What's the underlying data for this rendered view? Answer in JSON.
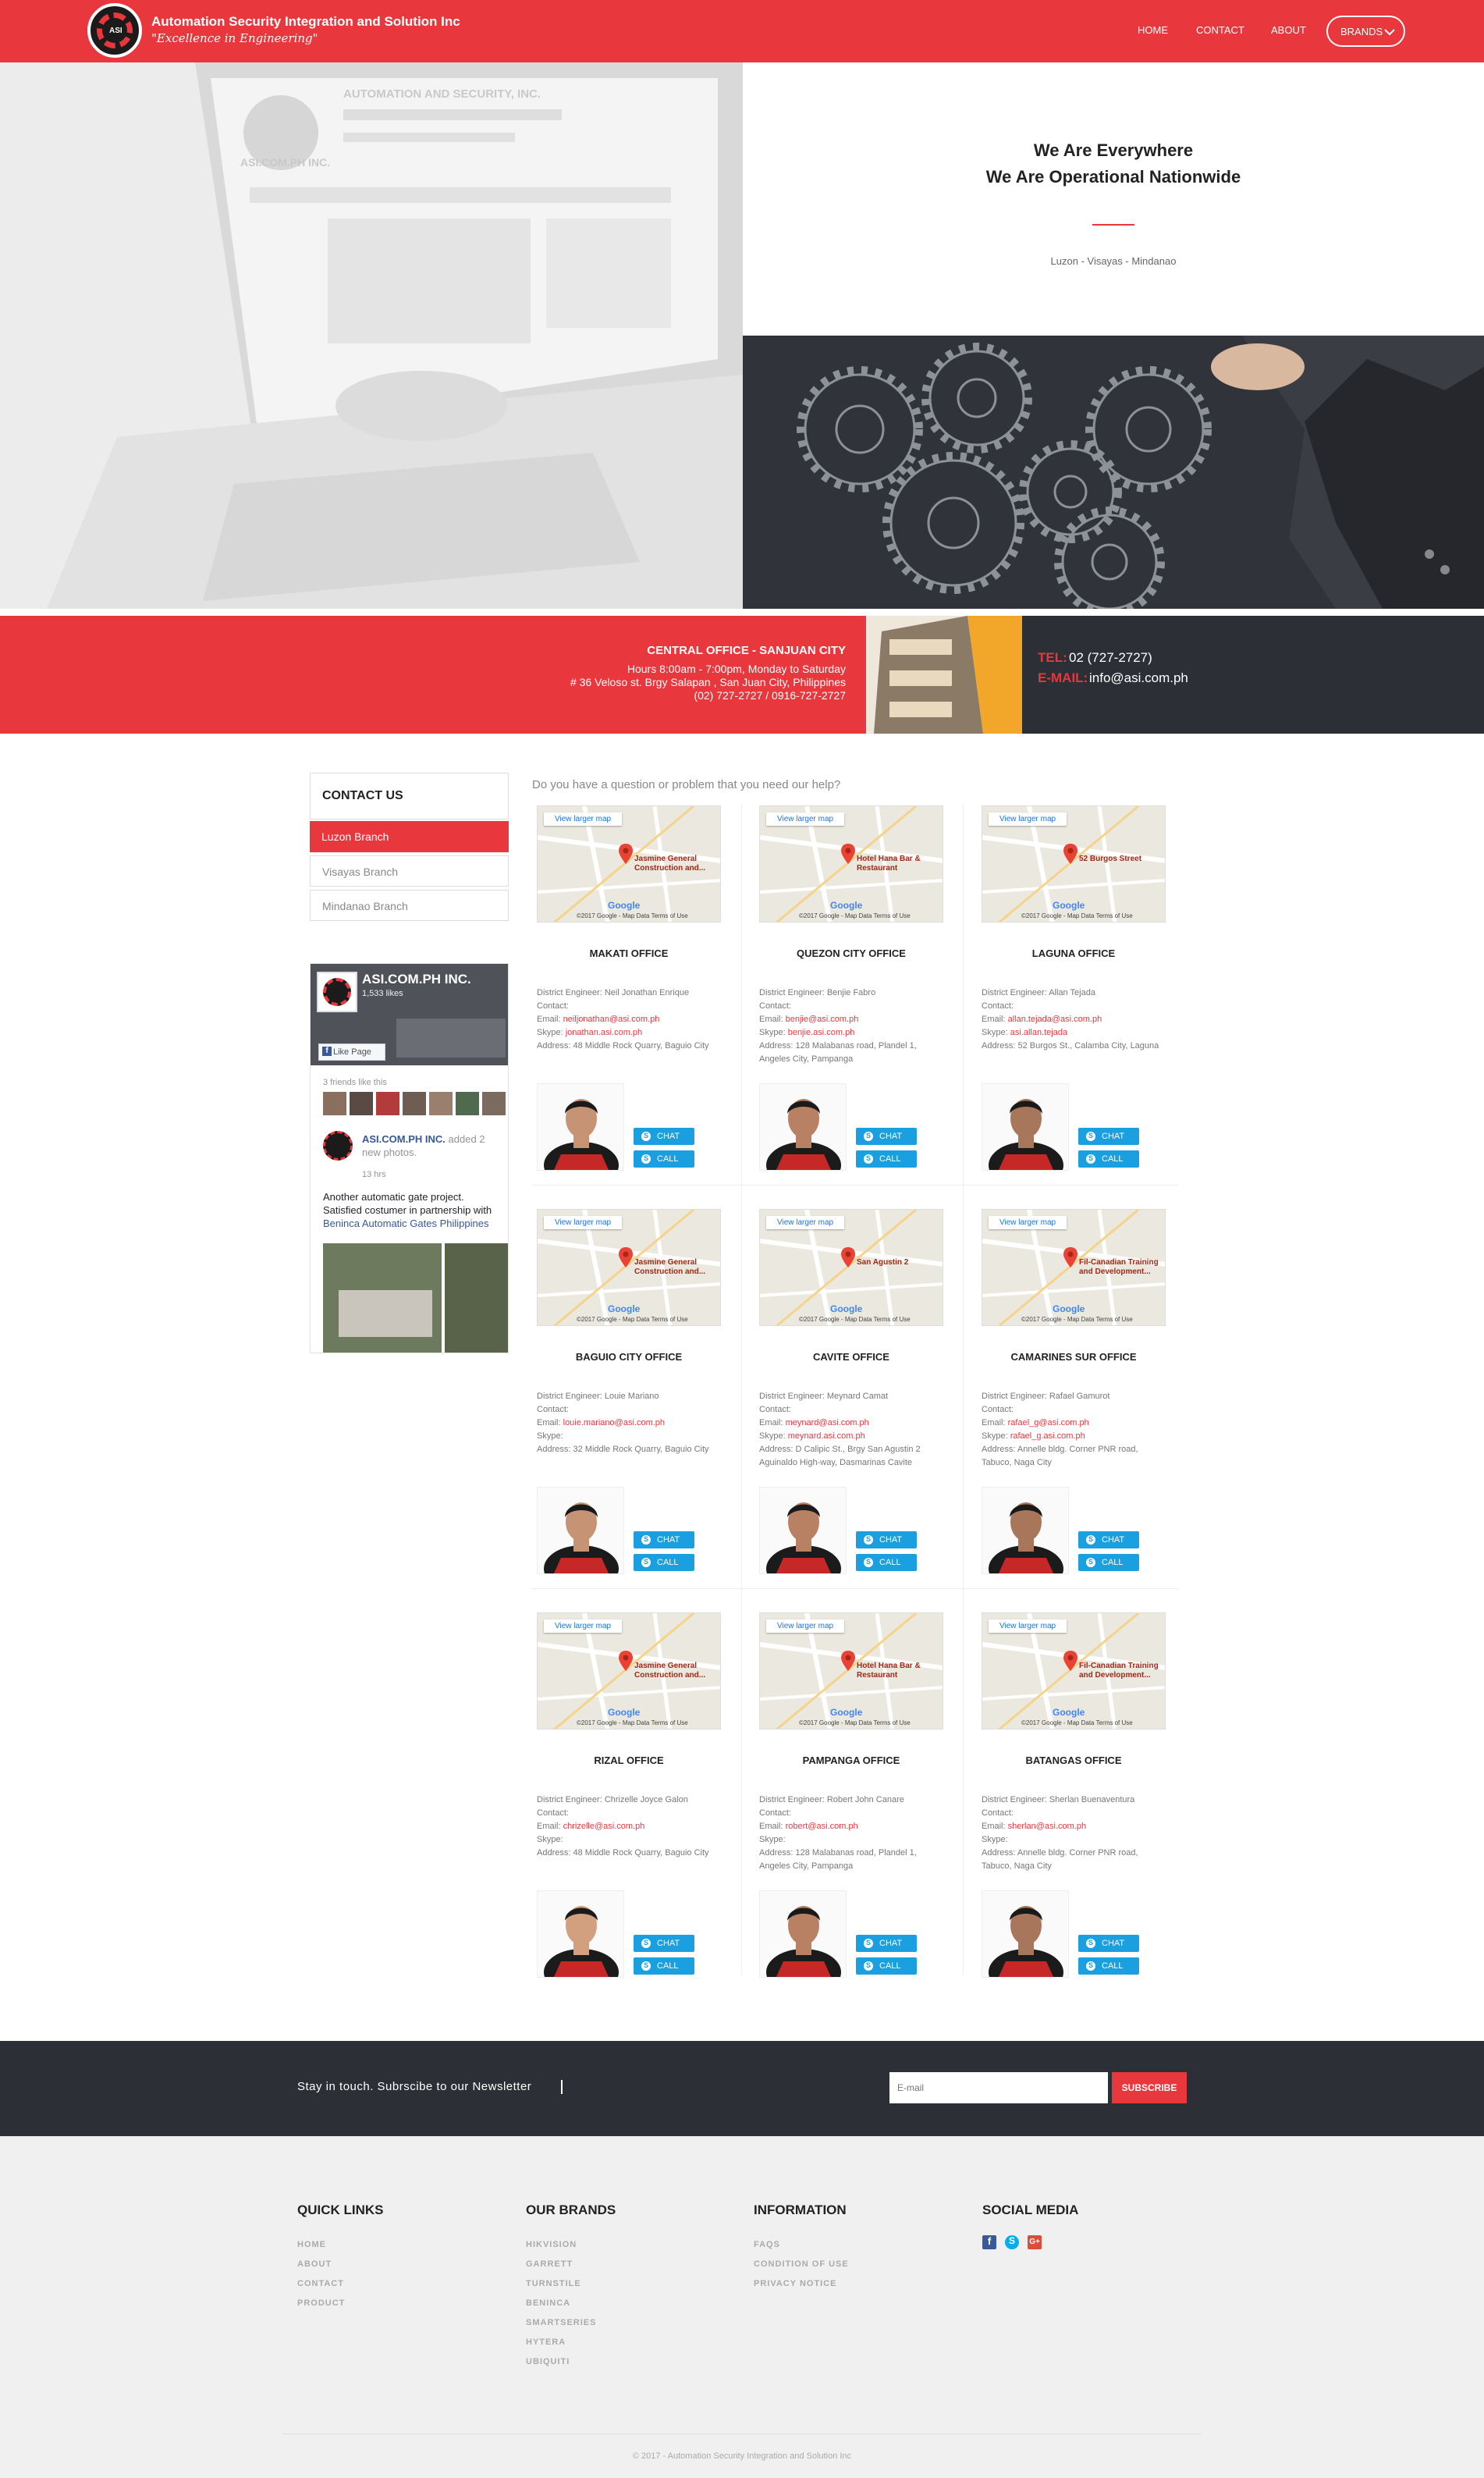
{
  "header": {
    "logo_text": "ASI",
    "brand_name": "Automation Security Integration and Solution Inc",
    "tagline": "\"Excellence in Engineering\"",
    "nav": [
      "HOME",
      "CONTACT",
      "ABOUT",
      "BRANDS"
    ]
  },
  "hero": {
    "title_line1": "We Are Everywhere",
    "title_line2": "We Are Operational Nationwide",
    "subtitle": "Luzon - Visayas - Mindanao",
    "screen_brand": "AUTOMATION AND SECURITY, INC.",
    "screen_site": "ASI.COM.PH INC."
  },
  "central": {
    "title": "CENTRAL OFFICE - SANJUAN CITY",
    "hours": "Hours 8:00am - 7:00pm, Monday to Saturday",
    "address": "# 36 Veloso st. Brgy Salapan , San Juan City, Philippines",
    "phones": "(02) 727-2727 / 0916-727-2727",
    "tel_label": "TEL:",
    "tel_value": "02 (727-2727)",
    "email_label": "E-MAIL:",
    "email_value": "info@asi.com.ph"
  },
  "sidebar": {
    "heading": "CONTACT US",
    "items": [
      "Luzon Branch",
      "Visayas Branch",
      "Mindanao Branch"
    ],
    "fb": {
      "page": "ASI.COM.PH INC.",
      "likes": "1,533 likes",
      "like_btn": "Like Page",
      "friends": "3 friends like this",
      "post_author": "ASI.COM.PH INC.",
      "post_action": "added 2 new photos.",
      "post_time": "13 hrs",
      "post_text1": "Another automatic gate project. Satisfied costumer in partnership with ",
      "post_link": "Beninca Automatic Gates Philippines"
    }
  },
  "main": {
    "question": "Do you have a question or problem that you need our help?",
    "map_link": "View larger map",
    "map_footer": "©2017 Google - Map Data   Terms of Use",
    "chat_label": "CHAT",
    "call_label": "CALL",
    "engineer_label": "District Engineer:",
    "contact_label": "Contact:",
    "email_label": "Email:",
    "skype_label": "Skype:",
    "address_label": "Address:",
    "offices": [
      {
        "title": "MAKATI OFFICE",
        "engineer": "Neil Jonathan Enrique",
        "email": "neiljonathan@asi.com.ph",
        "skype": "jonathan.asi.com.ph",
        "address": "48 Middle Rock Quarry, Baguio City",
        "map_pin": "Jasmine General Construction and..."
      },
      {
        "title": "QUEZON CITY OFFICE",
        "engineer": "Benjie Fabro",
        "email": "benjie@asi.com.ph",
        "skype": "benjie.asi.com.ph",
        "address": "128 Malabanas road, Plandel 1, Angeles City, Pampanga",
        "map_pin": "Hotel Hana Bar & Restaurant"
      },
      {
        "title": "LAGUNA OFFICE",
        "engineer": "Allan Tejada",
        "email": "allan.tejada@asi.com.ph",
        "skype": "asi.allan.tejada",
        "address": "52 Burgos St., Calamba City, Laguna",
        "map_pin": "52 Burgos Street"
      },
      {
        "title": "BAGUIO CITY OFFICE",
        "engineer": "Louie Mariano",
        "email": "louie.mariano@asi.com.ph",
        "skype": "",
        "address": "32 Middle Rock Quarry, Baguio City",
        "map_pin": "Jasmine General Construction and..."
      },
      {
        "title": "CAVITE OFFICE",
        "engineer": "Meynard Camat",
        "email": "meynard@asi.com.ph",
        "skype": "meynard.asi.com.ph",
        "address": "D Calipic St., Brgy San Agustin 2 Aguinaldo High-way, Dasmarinas Cavite",
        "map_pin": "San Agustin 2"
      },
      {
        "title": "CAMARINES SUR OFFICE",
        "engineer": "Rafael Gamurot",
        "email": "rafael_g@asi.com.ph",
        "skype": "rafael_g.asi.com.ph",
        "address": "Annelle bldg. Corner PNR road, Tabuco, Naga City",
        "map_pin": "Fil-Canadian Training and Development..."
      },
      {
        "title": "RIZAL OFFICE",
        "engineer": "Chrizelle Joyce Galon",
        "email": "chrizelle@asi.com.ph",
        "skype": "",
        "address": "48 Middle Rock Quarry, Baguio City",
        "map_pin": "Jasmine General Construction and..."
      },
      {
        "title": "PAMPANGA OFFICE",
        "engineer": "Robert John Canare",
        "email": "robert@asi.com.ph",
        "skype": "",
        "address": "128 Malabanas road, Plandel 1, Angeles City, Pampanga",
        "map_pin": "Hotel Hana Bar & Restaurant"
      },
      {
        "title": "BATANGAS OFFICE",
        "engineer": "Sherlan Buenaventura",
        "email": "sherlan@asi.com.ph",
        "skype": "",
        "address": "Annelle bldg. Corner PNR road, Tabuco, Naga City",
        "map_pin": "Fil-Canadian Training and Development..."
      }
    ]
  },
  "newsletter": {
    "text": "Stay in touch. Subrscibe to our Newsletter",
    "placeholder": "E-mail",
    "button": "SUBSCRIBE"
  },
  "footer": {
    "quick_links_title": "QUICK LINKS",
    "quick_links": [
      "HOME",
      "ABOUT",
      "CONTACT",
      "PRODUCT"
    ],
    "brands_title": "OUR BRANDS",
    "brands": [
      "HIKVISION",
      "GARRETT",
      "TURNSTILE",
      "BENINCA",
      "SMARTSERIES",
      "HYTERA",
      "UBIQUITI"
    ],
    "info_title": "INFORMATION",
    "info": [
      "FAQS",
      "CONDITION OF USE",
      "PRIVACY NOTICE"
    ],
    "social_title": "SOCIAL MEDIA",
    "social_icons": [
      "facebook-icon",
      "skype-icon",
      "google-plus-icon"
    ],
    "copyright": "© 2017 - Automation Security Integration and Solution Inc"
  },
  "colors": {
    "accent": "#e8373d",
    "dark": "#2c2f36",
    "chat": "#1a9fe0"
  }
}
